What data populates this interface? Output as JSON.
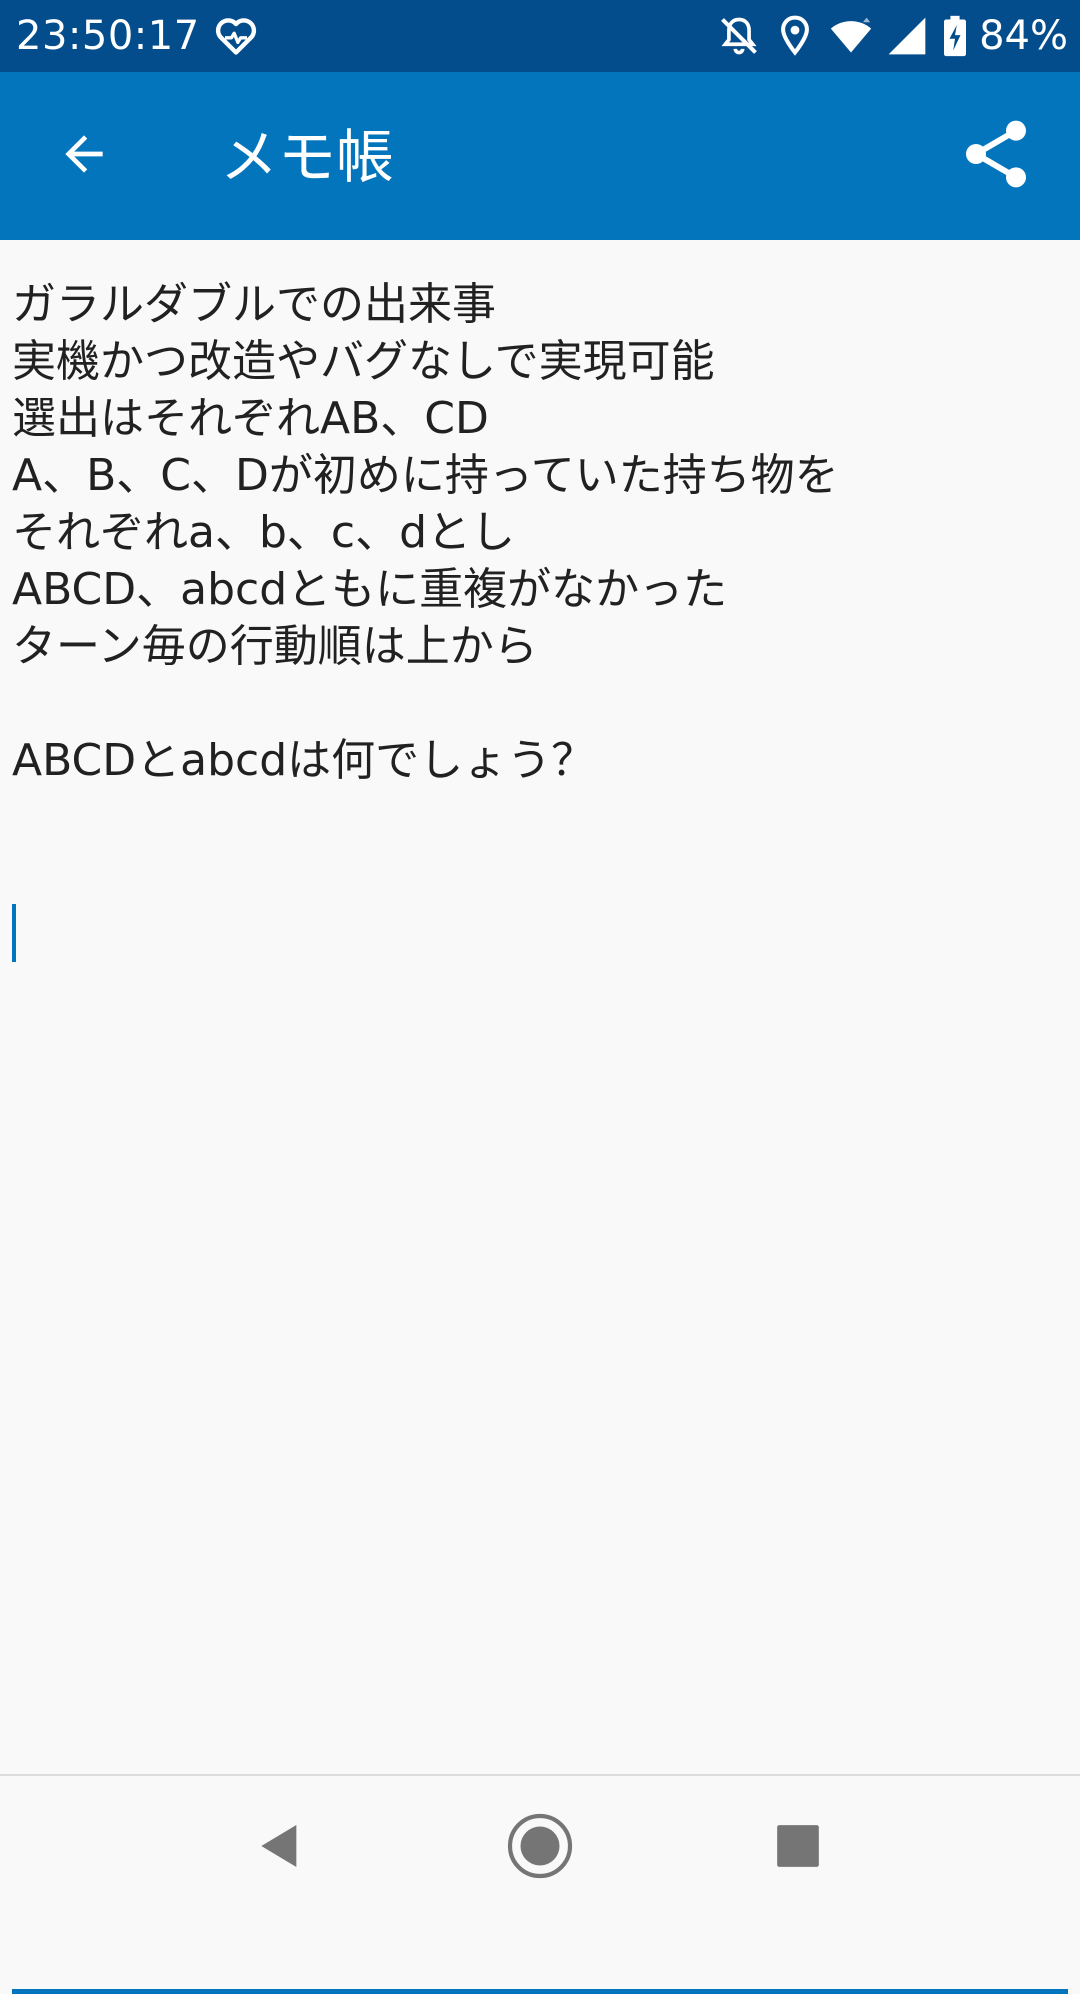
{
  "status_bar": {
    "time": "23:50:17",
    "battery_percent": "84%",
    "icons": [
      "heart-monitor-icon",
      "notifications-off-icon",
      "location-icon",
      "wifi-icon",
      "signal-icon",
      "battery-charging-icon"
    ]
  },
  "app_bar": {
    "title": "メモ帳",
    "back_icon": "arrow-back-icon",
    "share_icon": "share-icon"
  },
  "memo": {
    "text": "ガラルダブルでの出来事\n実機かつ改造やバグなしで実現可能\n選出はそれぞれAB、CD\nA、B、C、Dが初めに持っていた持ち物を\nそれぞれa、b、c、dとし\nABCD、abcdともに重複がなかった\nターン毎の行動順は上から\n\nABCDとabcdは何でしょう？"
  },
  "nav_bar": {
    "icons": [
      "nav-back-icon",
      "nav-home-icon",
      "nav-recents-icon"
    ]
  },
  "colors": {
    "status_bar": "#044d8c",
    "app_bar": "#0375bd",
    "accent": "#0375bd",
    "background": "#f9f9f9",
    "text": "#212121"
  }
}
